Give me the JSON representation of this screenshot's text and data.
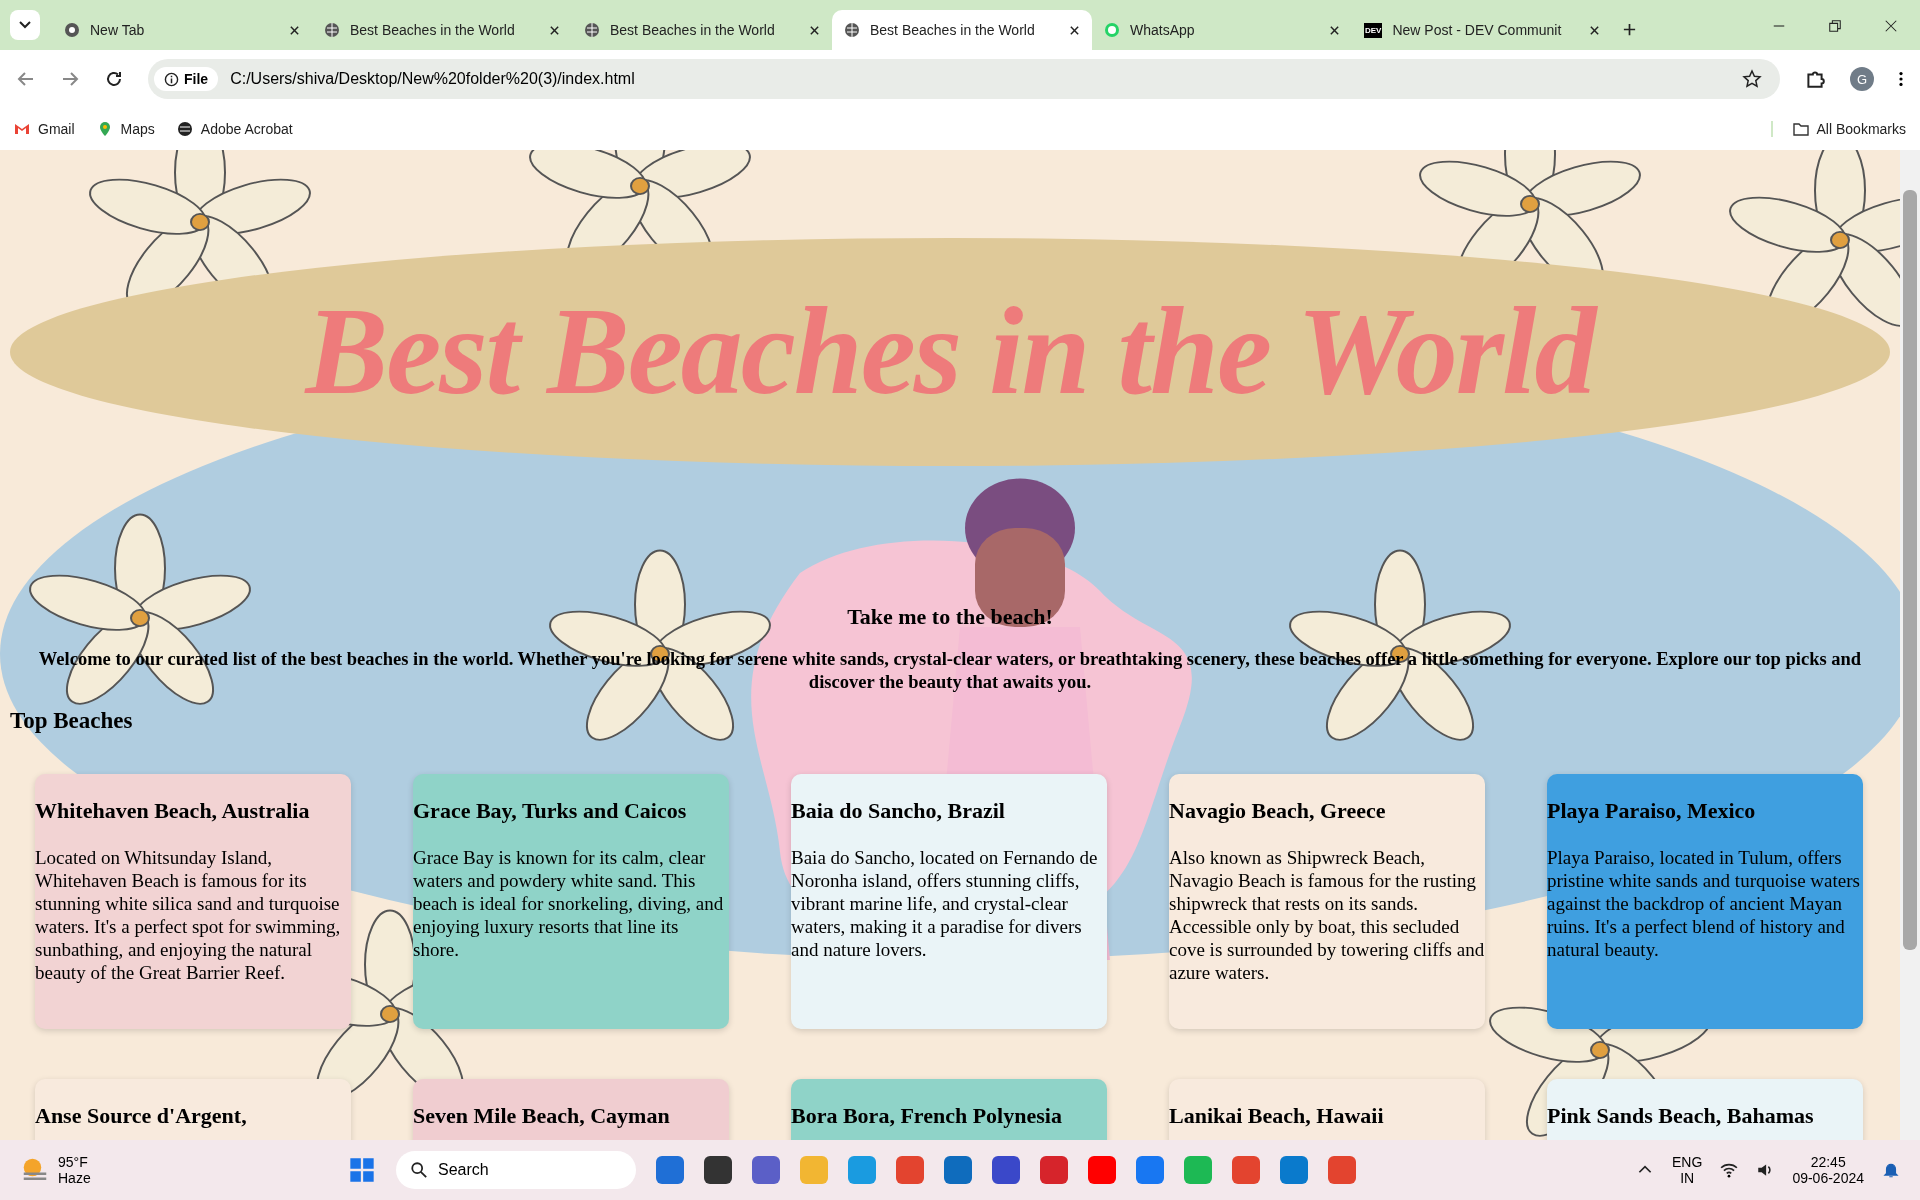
{
  "browser": {
    "tabs": [
      {
        "title": "New Tab",
        "kind": "chrome",
        "selected": false
      },
      {
        "title": "Best Beaches in the World",
        "kind": "globe",
        "selected": false
      },
      {
        "title": "Best Beaches in the World",
        "kind": "globe",
        "selected": false
      },
      {
        "title": "Best Beaches in the World",
        "kind": "globe",
        "selected": true
      },
      {
        "title": "WhatsApp",
        "kind": "chat",
        "selected": false
      },
      {
        "title": "New Post - DEV Communit",
        "kind": "dev",
        "selected": false
      }
    ],
    "dev_icon_text": "DEV",
    "address": {
      "badge": "File",
      "url": "C:/Users/shiva/Desktop/New%20folder%20(3)/index.html"
    },
    "profile_initial": "G",
    "bookmarks": [
      {
        "label": "Gmail",
        "kind": "mail"
      },
      {
        "label": "Maps",
        "kind": "pin"
      },
      {
        "label": "Adobe Acrobat",
        "kind": "globe"
      }
    ],
    "all_bookmarks": "All Bookmarks"
  },
  "page": {
    "banner_title": "Best Beaches in the World",
    "subtitle": "Take me to the beach!",
    "intro": "Welcome to our curated list of the best beaches in the world. Whether you're looking for serene white sands, crystal-clear waters, or breathtaking scenery, these beaches offer a little something for everyone. Explore our top picks and discover the beauty that awaits you.",
    "section_heading": "Top Beaches",
    "cards": [
      {
        "title": "Whitehaven Beach, Australia",
        "color": "#f2d3d3",
        "text": "Located on Whitsunday Island, Whitehaven Beach is famous for its stunning white silica sand and turquoise waters. It's a perfect spot for swimming, sunbathing, and enjoying the natural beauty of the Great Barrier Reef."
      },
      {
        "title": "Grace Bay, Turks and Caicos",
        "color": "#8fd3c8",
        "text": "Grace Bay is known for its calm, clear waters and powdery white sand. This beach is ideal for snorkeling, diving, and enjoying luxury resorts that line its shore."
      },
      {
        "title": "Baia do Sancho, Brazil",
        "color": "#eaf4f7",
        "text": "Baia do Sancho, located on Fernando de Noronha island, offers stunning cliffs, vibrant marine life, and crystal-clear waters, making it a paradise for divers and nature lovers."
      },
      {
        "title": "Navagio Beach, Greece",
        "color": "#f8eadd",
        "text": "Also known as Shipwreck Beach, Navagio Beach is famous for the rusting shipwreck that rests on its sands. Accessible only by boat, this secluded cove is surrounded by towering cliffs and azure waters."
      },
      {
        "title": "Playa Paraiso, Mexico",
        "color": "#3f9fe0",
        "text": "Playa Paraiso, located in Tulum, offers pristine white sands and turquoise waters against the backdrop of ancient Mayan ruins. It's a perfect blend of history and natural beauty."
      },
      {
        "title": "Anse Source d'Argent,",
        "color": "#f8eadd"
      },
      {
        "title": "Seven Mile Beach, Cayman",
        "color": "#f0cdd0"
      },
      {
        "title": "Bora Bora, French Polynesia",
        "color": "#8fd3c8"
      },
      {
        "title": "Lanikai Beach, Hawaii",
        "color": "#f8eadd"
      },
      {
        "title": "Pink Sands Beach, Bahamas",
        "color": "#eaf4f7"
      }
    ]
  },
  "taskbar": {
    "weather": {
      "temp": "95°F",
      "condition": "Haze"
    },
    "search": "Search",
    "language": [
      "ENG",
      "IN"
    ],
    "time": "22:45",
    "date": "09-06-2024"
  }
}
